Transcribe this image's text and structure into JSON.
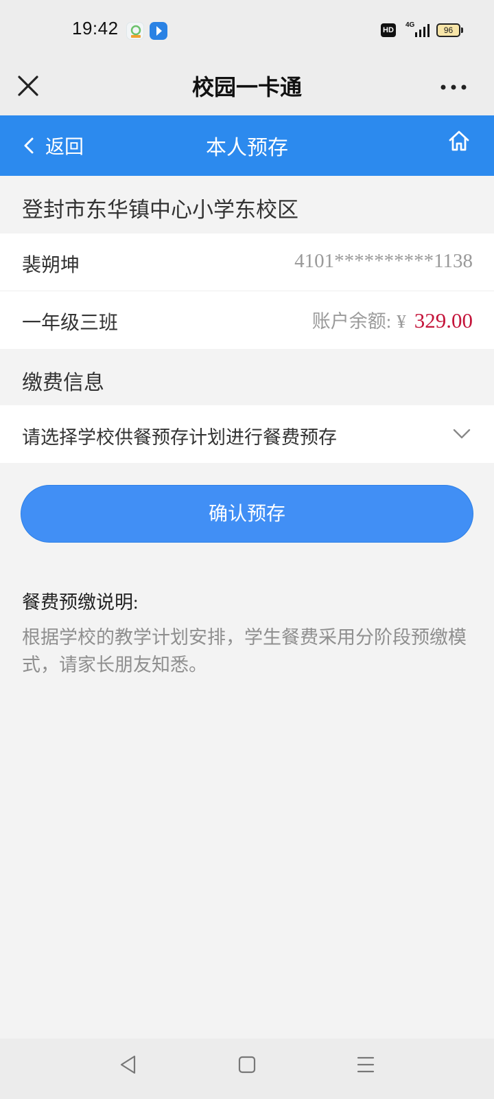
{
  "status_bar": {
    "time": "19:42",
    "hd": "HD",
    "network": "4G",
    "battery": "96"
  },
  "title_bar": {
    "title": "校园一卡通"
  },
  "nav": {
    "back_label": "返回",
    "title": "本人预存"
  },
  "school": {
    "name": "登封市东华镇中心小学东校区"
  },
  "student": {
    "name": "裴朔坤",
    "id_number": "4101**********1138"
  },
  "class_row": {
    "class_name": "一年级三班",
    "balance_label": "账户余额:",
    "currency": "¥",
    "balance": "329.00"
  },
  "payment": {
    "section_title": "缴费信息",
    "plan_placeholder": "请选择学校供餐预存计划进行餐费预存",
    "confirm_label": "确认预存"
  },
  "notes": {
    "title": "餐费预缴说明:",
    "body": "根据学校的教学计划安排，学生餐费采用分阶段预缴模式，请家长朋友知悉。"
  },
  "colors": {
    "accent": "#2c8aee",
    "button": "#418ff5",
    "balance": "#c4143a"
  },
  "icons": [
    "close-icon",
    "more-icon",
    "chevron-left-icon",
    "home-icon",
    "chevron-down-icon",
    "back-triangle-icon",
    "square-icon",
    "menu-icon"
  ]
}
